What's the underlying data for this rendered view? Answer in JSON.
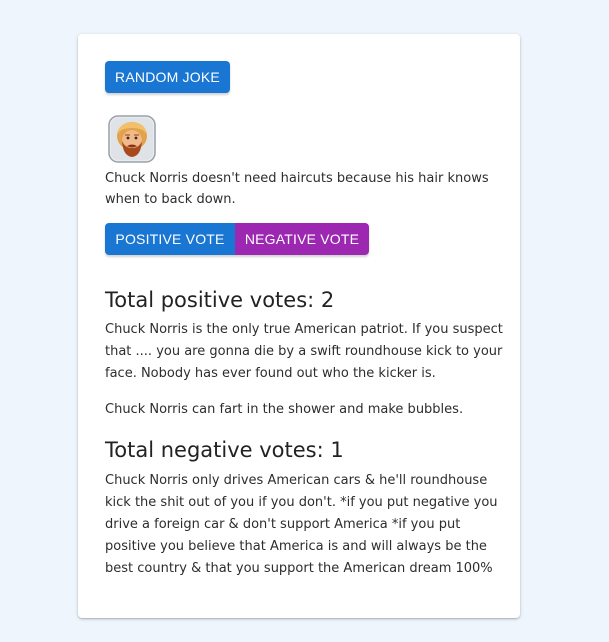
{
  "actions": {
    "random_label": "RANDOM JOKE",
    "positive_label": "POSITIVE VOTE",
    "negative_label": "NEGATIVE VOTE"
  },
  "current_joke": {
    "icon": "chuck-norris-avatar-icon",
    "text": "Chuck Norris doesn't need haircuts because his hair knows when to back down."
  },
  "positive": {
    "heading": "Total positive votes: 2",
    "jokes": [
      "Chuck Norris is the only true American patriot. If you suspect that .... you are gonna die by a swift roundhouse kick to your face. Nobody has ever found out who the kicker is.",
      "Chuck Norris can fart in the shower and make bubbles."
    ]
  },
  "negative": {
    "heading": "Total negative votes: 1",
    "jokes": [
      "Chuck Norris only drives American cars & he'll roundhouse kick the shit out of you if you don't. *if you put negative you drive a foreign car & don't support America *if you put positive you believe that America is and will always be the best country & that you support the American dream 100%"
    ]
  },
  "colors": {
    "page_bg": "#eef5fd",
    "primary": "#1976d2",
    "secondary": "#9c27b0"
  }
}
